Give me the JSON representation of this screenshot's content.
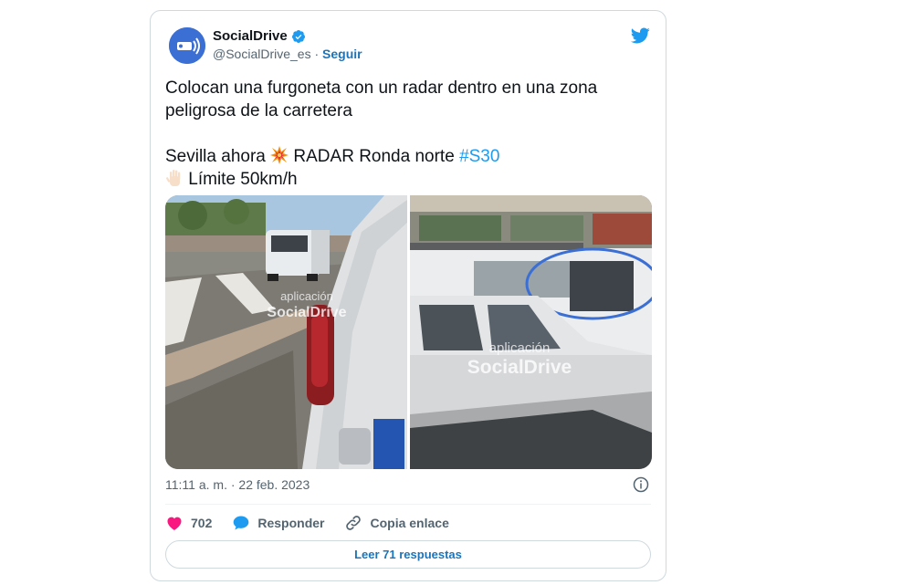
{
  "tweet": {
    "author": {
      "name": "SocialDrive",
      "handle": "@SocialDrive_es",
      "separator": "·",
      "follow_label": "Seguir"
    },
    "text": {
      "line1": "Colocan una furgoneta con un radar dentro en una zona",
      "line2": "peligrosa de la carretera",
      "line3_prefix": "Sevilla ahora",
      "line3_middle": "RADAR Ronda norte",
      "hashtag": "#S30",
      "line4": "Límite 50km/h"
    },
    "media": {
      "left_watermark_line1": "aplicación",
      "left_watermark_line2": "SocialDrive",
      "right_watermark_line1": "aplicación",
      "right_watermark_line2": "SocialDrive"
    },
    "timestamp": "11:11 a. m. · 22 feb. 2023",
    "actions": {
      "likes": "702",
      "reply_label": "Responder",
      "copy_link_label": "Copia enlace"
    },
    "read_replies_label": "Leer 71 respuestas"
  },
  "colors": {
    "link_blue": "#1d74b8",
    "hashtag_blue": "#1d9bf0",
    "heart_pink": "#f91880",
    "twitter_blue": "#1d9bf0",
    "border": "#cfd9de",
    "muted_text": "#536471"
  },
  "icons": {
    "avatar": "radar-avatar-icon",
    "verified": "verified-badge-icon",
    "brand": "twitter-bird-icon",
    "explosion": "collision-emoji-icon",
    "hand": "raised-hand-emoji-icon",
    "info": "info-icon",
    "like": "heart-icon",
    "reply": "speech-bubble-icon",
    "copy_link": "link-icon"
  }
}
